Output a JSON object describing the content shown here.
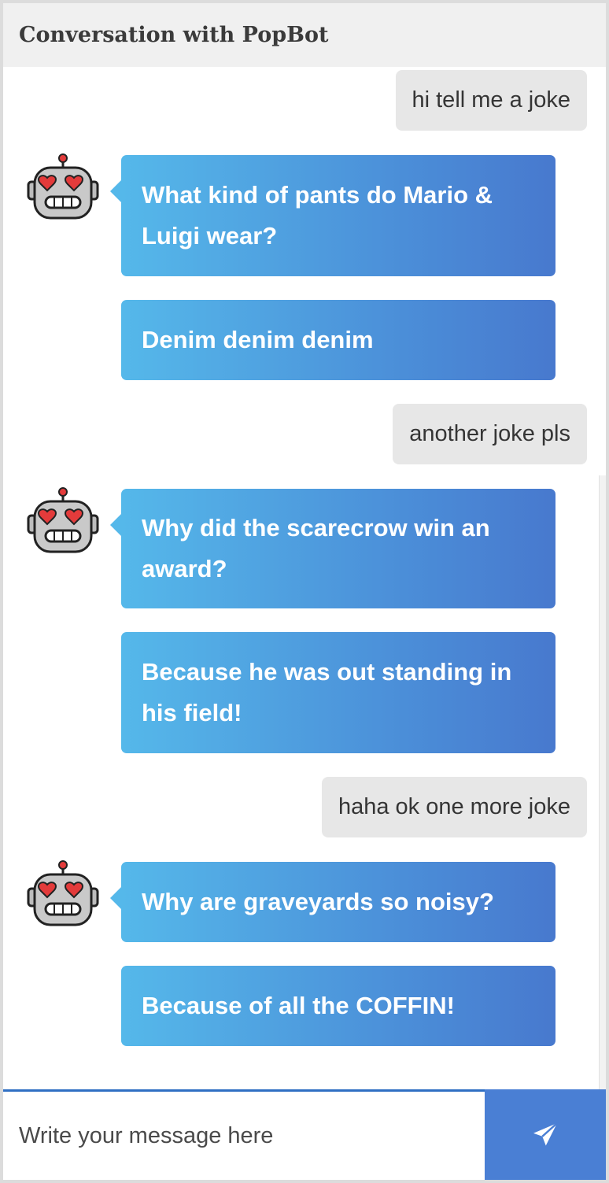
{
  "header": {
    "title": "Conversation with PopBot"
  },
  "messages": [
    {
      "from": "user",
      "text": "hi tell me a joke"
    },
    {
      "from": "bot",
      "text": "What kind of pants do Mario & Luigi wear?"
    },
    {
      "from": "bot",
      "text": "Denim denim denim"
    },
    {
      "from": "user",
      "text": "another joke pls"
    },
    {
      "from": "bot",
      "text": "Why did the scarecrow win an award?"
    },
    {
      "from": "bot",
      "text": "Because he was out standing in his field!"
    },
    {
      "from": "user",
      "text": "haha ok one more joke"
    },
    {
      "from": "bot",
      "text": "Why are graveyards so noisy?"
    },
    {
      "from": "bot",
      "text": "Because of all the COFFIN!"
    }
  ],
  "composer": {
    "placeholder": "Write your message here",
    "value": "",
    "send_icon": "paper-plane-icon"
  },
  "avatar_icon": "robot-heart-eyes-icon",
  "colors": {
    "bot_bubble_start": "#55b8ea",
    "bot_bubble_end": "#4879ce",
    "user_bubble": "#e7e7e7",
    "send_button": "#4a7fd4",
    "header_bg": "#f0f0f0"
  }
}
